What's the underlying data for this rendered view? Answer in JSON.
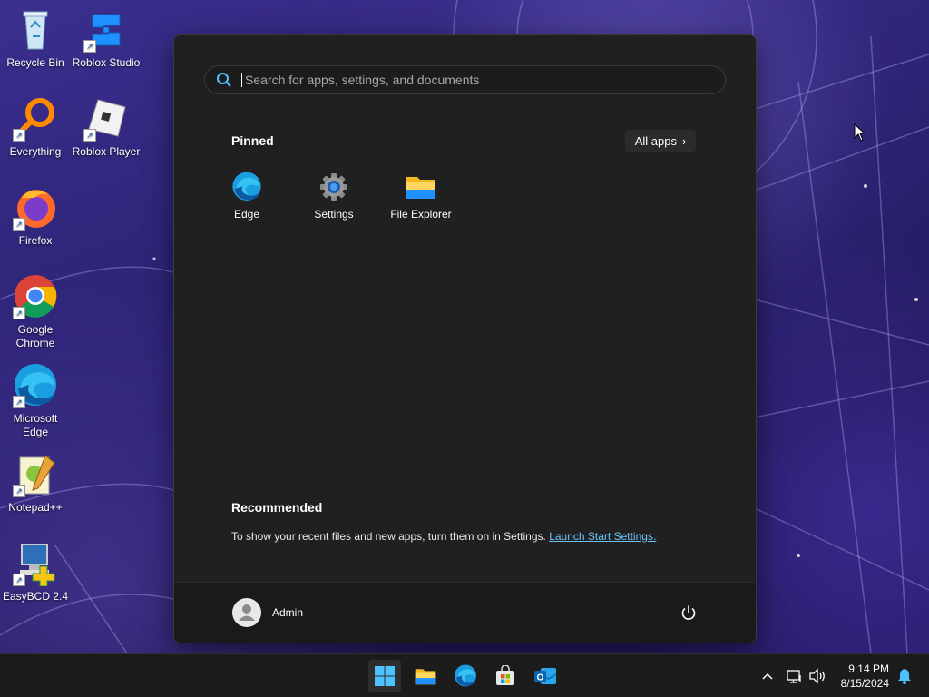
{
  "desktop_icons": [
    {
      "label": "Recycle Bin",
      "icon": "recycle-bin-icon"
    },
    {
      "label": "Roblox Studio",
      "icon": "roblox-studio-icon"
    },
    {
      "label": "Everything",
      "icon": "everything-search-icon"
    },
    {
      "label": "Roblox Player",
      "icon": "roblox-player-icon"
    },
    {
      "label": "Firefox",
      "icon": "firefox-icon"
    },
    {
      "label": "Google Chrome",
      "icon": "chrome-icon"
    },
    {
      "label": "Microsoft Edge",
      "icon": "edge-icon"
    },
    {
      "label": "Notepad++",
      "icon": "notepad-plus-plus-icon"
    },
    {
      "label": "EasyBCD 2.4",
      "icon": "easybcd-icon"
    }
  ],
  "start_menu": {
    "search": {
      "placeholder": "Search for apps, settings, and documents",
      "value": ""
    },
    "pinned_title": "Pinned",
    "all_apps_label": "All apps",
    "pinned_apps": [
      {
        "label": "Edge",
        "icon": "edge-icon"
      },
      {
        "label": "Settings",
        "icon": "settings-gear-icon"
      },
      {
        "label": "File Explorer",
        "icon": "file-explorer-folder-icon"
      }
    ],
    "recommended_title": "Recommended",
    "recommended_text": "To show your recent files and new apps, turn them on in Settings.",
    "recommended_link": "Launch Start Settings.",
    "user_name": "Admin"
  },
  "taskbar": {
    "apps": [
      "start-button",
      "file-explorer",
      "edge",
      "microsoft-store",
      "outlook"
    ],
    "tray": [
      "show-hidden-icons",
      "network-icon",
      "volume-icon"
    ],
    "time": "9:14 PM",
    "date": "8/15/2024"
  },
  "colors": {
    "menu_bg": "#202020",
    "accent_link": "#6cc4ff",
    "taskbar_bg": "#1c1c1c"
  }
}
